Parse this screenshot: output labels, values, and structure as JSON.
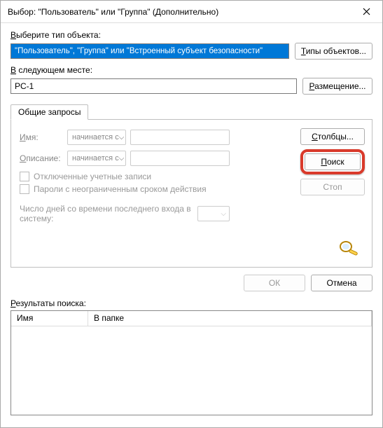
{
  "window": {
    "title": "Выбор: \"Пользователь\" или \"Группа\" (Дополнительно)"
  },
  "objectType": {
    "label_pre": "В",
    "label_rest": "ыберите тип объекта:",
    "value": "\"Пользователь\", \"Группа\" или \"Встроенный субъект безопасности\"",
    "button_u": "Т",
    "button_rest": "ипы объектов..."
  },
  "location": {
    "label_u": "В",
    "label_rest": " следующем месте:",
    "value": "PC-1",
    "button_u": "Р",
    "button_rest": "азмещение..."
  },
  "tab": {
    "label": "Общие запросы"
  },
  "form": {
    "name_u": "И",
    "name_rest": "мя:",
    "desc_u": "О",
    "desc_rest": "писание:",
    "dd_value": "начинается с",
    "chk1_u": "О",
    "chk1_rest": "тключенные учетные записи",
    "chk2": "Пароли с неограниченным сроком действия",
    "days_label": "Число дней со времени последнего входа в систему:"
  },
  "side": {
    "columns_u": "С",
    "columns_rest": "толбцы...",
    "search_u": "П",
    "search_rest": "оиск",
    "stop": "Стоп"
  },
  "footer": {
    "ok": "ОК",
    "cancel": "Отмена"
  },
  "results": {
    "label_u": "Р",
    "label_rest": "езультаты поиска:",
    "col1": "Имя",
    "col2": "В папке"
  }
}
